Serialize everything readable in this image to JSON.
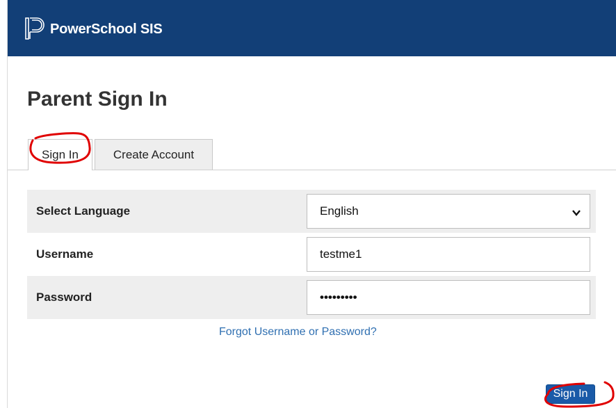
{
  "header": {
    "app_title": "PowerSchool SIS",
    "background_color": "#123f77",
    "logo_icon": "powerschool-logo-icon"
  },
  "page": {
    "title": "Parent Sign In"
  },
  "tabs": [
    {
      "label": "Sign In",
      "selected": true
    },
    {
      "label": "Create Account",
      "selected": false
    }
  ],
  "form": {
    "language": {
      "label": "Select Language",
      "value": "English",
      "icon": "chevron-down-icon"
    },
    "username": {
      "label": "Username",
      "value": "testme1"
    },
    "password": {
      "label": "Password",
      "masked_value": "•••••••••"
    }
  },
  "links": {
    "forgot": "Forgot Username or Password?"
  },
  "actions": {
    "signin_button": "Sign In",
    "button_color": "#1a5aa8"
  },
  "annotations": {
    "highlight_color": "#e00000",
    "icon": "red-circle-annotation"
  }
}
